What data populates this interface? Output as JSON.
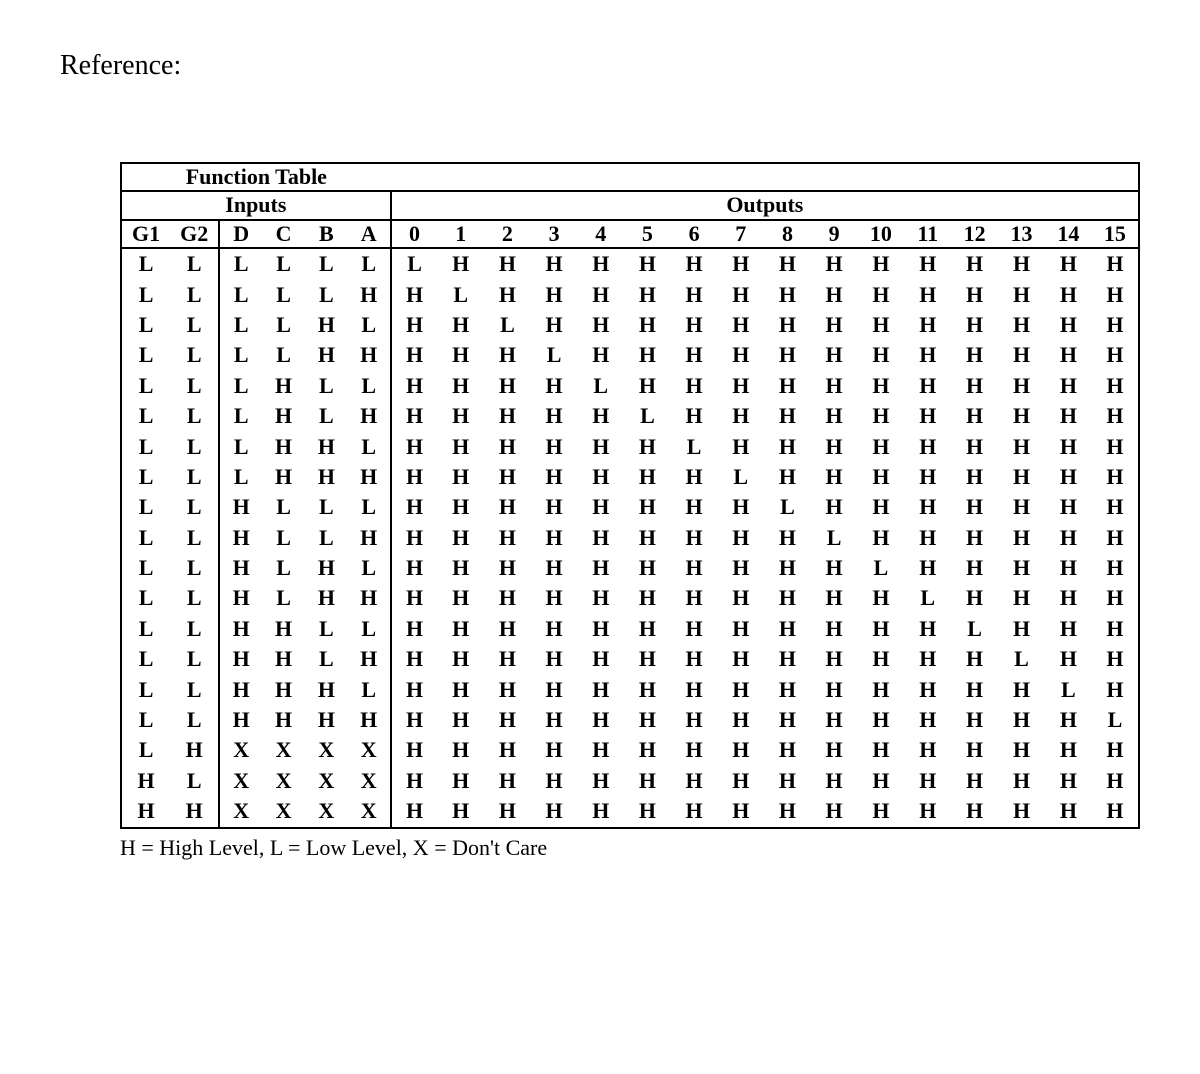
{
  "reference_label": "Reference:",
  "table_title": "Function Table",
  "group_headers": {
    "inputs": "Inputs",
    "outputs": "Outputs"
  },
  "columns": {
    "g": [
      "G1",
      "G2"
    ],
    "dcba": [
      "D",
      "C",
      "B",
      "A"
    ],
    "outputs": [
      "0",
      "1",
      "2",
      "3",
      "4",
      "5",
      "6",
      "7",
      "8",
      "9",
      "10",
      "11",
      "12",
      "13",
      "14",
      "15"
    ]
  },
  "rows": [
    {
      "g": [
        "L",
        "L"
      ],
      "dcba": [
        "L",
        "L",
        "L",
        "L"
      ],
      "out": [
        "L",
        "H",
        "H",
        "H",
        "H",
        "H",
        "H",
        "H",
        "H",
        "H",
        "H",
        "H",
        "H",
        "H",
        "H",
        "H"
      ]
    },
    {
      "g": [
        "L",
        "L"
      ],
      "dcba": [
        "L",
        "L",
        "L",
        "H"
      ],
      "out": [
        "H",
        "L",
        "H",
        "H",
        "H",
        "H",
        "H",
        "H",
        "H",
        "H",
        "H",
        "H",
        "H",
        "H",
        "H",
        "H"
      ]
    },
    {
      "g": [
        "L",
        "L"
      ],
      "dcba": [
        "L",
        "L",
        "H",
        "L"
      ],
      "out": [
        "H",
        "H",
        "L",
        "H",
        "H",
        "H",
        "H",
        "H",
        "H",
        "H",
        "H",
        "H",
        "H",
        "H",
        "H",
        "H"
      ]
    },
    {
      "g": [
        "L",
        "L"
      ],
      "dcba": [
        "L",
        "L",
        "H",
        "H"
      ],
      "out": [
        "H",
        "H",
        "H",
        "L",
        "H",
        "H",
        "H",
        "H",
        "H",
        "H",
        "H",
        "H",
        "H",
        "H",
        "H",
        "H"
      ]
    },
    {
      "g": [
        "L",
        "L"
      ],
      "dcba": [
        "L",
        "H",
        "L",
        "L"
      ],
      "out": [
        "H",
        "H",
        "H",
        "H",
        "L",
        "H",
        "H",
        "H",
        "H",
        "H",
        "H",
        "H",
        "H",
        "H",
        "H",
        "H"
      ]
    },
    {
      "g": [
        "L",
        "L"
      ],
      "dcba": [
        "L",
        "H",
        "L",
        "H"
      ],
      "out": [
        "H",
        "H",
        "H",
        "H",
        "H",
        "L",
        "H",
        "H",
        "H",
        "H",
        "H",
        "H",
        "H",
        "H",
        "H",
        "H"
      ]
    },
    {
      "g": [
        "L",
        "L"
      ],
      "dcba": [
        "L",
        "H",
        "H",
        "L"
      ],
      "out": [
        "H",
        "H",
        "H",
        "H",
        "H",
        "H",
        "L",
        "H",
        "H",
        "H",
        "H",
        "H",
        "H",
        "H",
        "H",
        "H"
      ]
    },
    {
      "g": [
        "L",
        "L"
      ],
      "dcba": [
        "L",
        "H",
        "H",
        "H"
      ],
      "out": [
        "H",
        "H",
        "H",
        "H",
        "H",
        "H",
        "H",
        "L",
        "H",
        "H",
        "H",
        "H",
        "H",
        "H",
        "H",
        "H"
      ]
    },
    {
      "g": [
        "L",
        "L"
      ],
      "dcba": [
        "H",
        "L",
        "L",
        "L"
      ],
      "out": [
        "H",
        "H",
        "H",
        "H",
        "H",
        "H",
        "H",
        "H",
        "L",
        "H",
        "H",
        "H",
        "H",
        "H",
        "H",
        "H"
      ]
    },
    {
      "g": [
        "L",
        "L"
      ],
      "dcba": [
        "H",
        "L",
        "L",
        "H"
      ],
      "out": [
        "H",
        "H",
        "H",
        "H",
        "H",
        "H",
        "H",
        "H",
        "H",
        "L",
        "H",
        "H",
        "H",
        "H",
        "H",
        "H"
      ]
    },
    {
      "g": [
        "L",
        "L"
      ],
      "dcba": [
        "H",
        "L",
        "H",
        "L"
      ],
      "out": [
        "H",
        "H",
        "H",
        "H",
        "H",
        "H",
        "H",
        "H",
        "H",
        "H",
        "L",
        "H",
        "H",
        "H",
        "H",
        "H"
      ]
    },
    {
      "g": [
        "L",
        "L"
      ],
      "dcba": [
        "H",
        "L",
        "H",
        "H"
      ],
      "out": [
        "H",
        "H",
        "H",
        "H",
        "H",
        "H",
        "H",
        "H",
        "H",
        "H",
        "H",
        "L",
        "H",
        "H",
        "H",
        "H"
      ]
    },
    {
      "g": [
        "L",
        "L"
      ],
      "dcba": [
        "H",
        "H",
        "L",
        "L"
      ],
      "out": [
        "H",
        "H",
        "H",
        "H",
        "H",
        "H",
        "H",
        "H",
        "H",
        "H",
        "H",
        "H",
        "L",
        "H",
        "H",
        "H"
      ]
    },
    {
      "g": [
        "L",
        "L"
      ],
      "dcba": [
        "H",
        "H",
        "L",
        "H"
      ],
      "out": [
        "H",
        "H",
        "H",
        "H",
        "H",
        "H",
        "H",
        "H",
        "H",
        "H",
        "H",
        "H",
        "H",
        "L",
        "H",
        "H"
      ]
    },
    {
      "g": [
        "L",
        "L"
      ],
      "dcba": [
        "H",
        "H",
        "H",
        "L"
      ],
      "out": [
        "H",
        "H",
        "H",
        "H",
        "H",
        "H",
        "H",
        "H",
        "H",
        "H",
        "H",
        "H",
        "H",
        "H",
        "L",
        "H"
      ]
    },
    {
      "g": [
        "L",
        "L"
      ],
      "dcba": [
        "H",
        "H",
        "H",
        "H"
      ],
      "out": [
        "H",
        "H",
        "H",
        "H",
        "H",
        "H",
        "H",
        "H",
        "H",
        "H",
        "H",
        "H",
        "H",
        "H",
        "H",
        "L"
      ]
    },
    {
      "g": [
        "L",
        "H"
      ],
      "dcba": [
        "X",
        "X",
        "X",
        "X"
      ],
      "out": [
        "H",
        "H",
        "H",
        "H",
        "H",
        "H",
        "H",
        "H",
        "H",
        "H",
        "H",
        "H",
        "H",
        "H",
        "H",
        "H"
      ]
    },
    {
      "g": [
        "H",
        "L"
      ],
      "dcba": [
        "X",
        "X",
        "X",
        "X"
      ],
      "out": [
        "H",
        "H",
        "H",
        "H",
        "H",
        "H",
        "H",
        "H",
        "H",
        "H",
        "H",
        "H",
        "H",
        "H",
        "H",
        "H"
      ]
    },
    {
      "g": [
        "H",
        "H"
      ],
      "dcba": [
        "X",
        "X",
        "X",
        "X"
      ],
      "out": [
        "H",
        "H",
        "H",
        "H",
        "H",
        "H",
        "H",
        "H",
        "H",
        "H",
        "H",
        "H",
        "H",
        "H",
        "H",
        "H"
      ]
    }
  ],
  "legend": "H = High Level, L = Low Level, X = Don't Care"
}
